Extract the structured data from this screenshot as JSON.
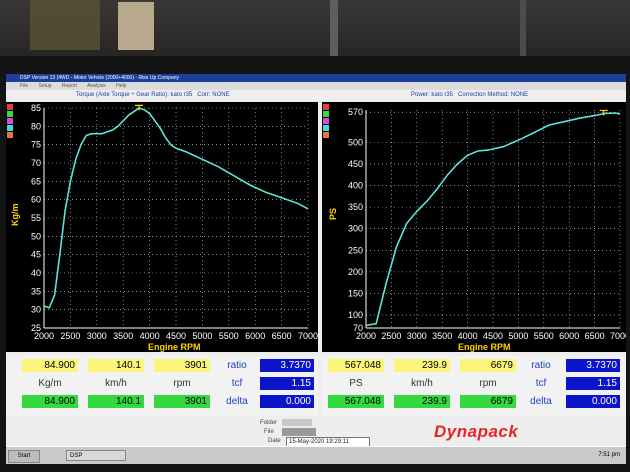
{
  "window": {
    "title": "DSP Version 13 (4WD - Motor Vehicle (2000+4000) - Rise Up Company",
    "menu": [
      "File",
      "Setup",
      "Report",
      "Analysis",
      "Help"
    ]
  },
  "left_chart_header": {
    "measure": "Torque (Axle Torque ÷ Gear Ratio): kato r35",
    "corr": "Corr: NONE"
  },
  "right_chart_header": {
    "power": "Power: kato r35",
    "corr": "Correction Method: NONE"
  },
  "chart_data": [
    {
      "type": "line",
      "ylabel": "Kg/m",
      "xlabel": "Engine RPM",
      "xlim": [
        2000,
        7000
      ],
      "ylim": [
        25,
        85
      ],
      "xticks": [
        "2000",
        "2500",
        "3000",
        "3500",
        "4000",
        "4500",
        "5000",
        "5500",
        "6000",
        "6500",
        "7000"
      ],
      "yticks": [
        "85",
        "80",
        "75",
        "70",
        "65",
        "60",
        "55",
        "50",
        "45",
        "40",
        "35",
        "30",
        "25"
      ],
      "series": [
        {
          "color": "#5ee3d8",
          "x": [
            2000,
            2100,
            2200,
            2300,
            2400,
            2500,
            2600,
            2700,
            2800,
            2900,
            3000,
            3100,
            3200,
            3300,
            3400,
            3500,
            3600,
            3700,
            3800,
            3900,
            4000,
            4100,
            4200,
            4300,
            4400,
            4500,
            4700,
            5000,
            5300,
            5600,
            5900,
            6200,
            6500,
            6800,
            7000
          ],
          "y": [
            31,
            30.5,
            34,
            45,
            57,
            65,
            71,
            75,
            77.5,
            78,
            78,
            78,
            78.5,
            79,
            80,
            81.5,
            83,
            84,
            85,
            84.5,
            83.5,
            81.5,
            79.5,
            77,
            75,
            74,
            73,
            71,
            69,
            66.5,
            64,
            62,
            60.5,
            59,
            57.5
          ]
        }
      ],
      "marker": {
        "x": 3800,
        "y": 84.9
      }
    },
    {
      "type": "line",
      "ylabel": "PS",
      "xlabel": "Engine RPM",
      "xlim": [
        2000,
        7000
      ],
      "ylim": [
        70,
        575
      ],
      "xticks": [
        "2000",
        "2500",
        "3000",
        "3500",
        "4000",
        "4500",
        "5000",
        "5500",
        "6000",
        "6500",
        "7000"
      ],
      "yticks": [
        "570",
        "500",
        "450",
        "400",
        "350",
        "300",
        "250",
        "200",
        "150",
        "100",
        "70"
      ],
      "series": [
        {
          "color": "#5ee3d8",
          "x": [
            2000,
            2200,
            2400,
            2600,
            2800,
            3000,
            3200,
            3400,
            3600,
            3800,
            4000,
            4200,
            4400,
            4700,
            5000,
            5300,
            5600,
            5900,
            6200,
            6500,
            6700,
            6900,
            7000
          ],
          "y": [
            76,
            80,
            175,
            258,
            312,
            340,
            364,
            392,
            424,
            450,
            470,
            480,
            482,
            490,
            505,
            522,
            540,
            548,
            556,
            562,
            567,
            568,
            566
          ]
        }
      ],
      "marker": {
        "x": 6679,
        "y": 567
      }
    }
  ],
  "left_panel": {
    "row1": [
      "84.900",
      "140.1",
      "3901",
      "ratio",
      "3.7370"
    ],
    "row2": [
      "Kg/m",
      "km/h",
      "rpm",
      "tcf",
      "1.15"
    ],
    "row3": [
      "84.900",
      "140.1",
      "3901",
      "delta",
      "0.000"
    ]
  },
  "right_panel": {
    "row1": [
      "567.048",
      "239.9",
      "6679",
      "ratio",
      "3.7370"
    ],
    "row2": [
      "PS",
      "km/h",
      "rpm",
      "tcf",
      "1.15"
    ],
    "row3": [
      "567.048",
      "239.9",
      "6679",
      "delta",
      "0.000"
    ]
  },
  "footer": {
    "folder_label": "Folder",
    "file_label": "File",
    "date_label": "Date",
    "date_value": "15-May-2020 19:29:11",
    "logo": "Dynapack"
  },
  "taskbar": {
    "start": "Start",
    "task": "DSP",
    "clock": "7:51 pm"
  },
  "colors": {
    "curve": "#5ee3d8",
    "axis_title": "#ffd400",
    "yellow_cell": "#fbf57c",
    "green_cell": "#33d93f",
    "navy_cell": "#0c14c8",
    "logo": "#e8232a"
  }
}
